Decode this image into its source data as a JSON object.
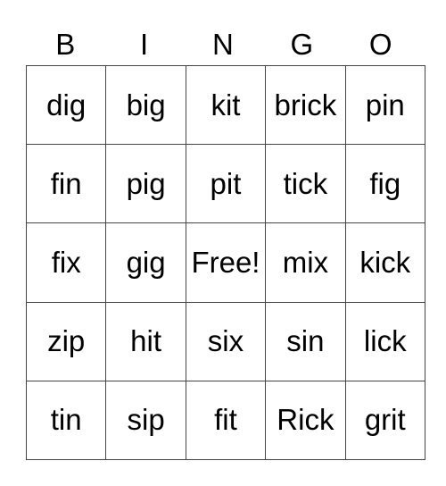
{
  "header": [
    "B",
    "I",
    "N",
    "G",
    "O"
  ],
  "rows": [
    [
      "dig",
      "big",
      "kit",
      "brick",
      "pin"
    ],
    [
      "fin",
      "pig",
      "pit",
      "tick",
      "fig"
    ],
    [
      "fix",
      "gig",
      "Free!",
      "mix",
      "kick"
    ],
    [
      "zip",
      "hit",
      "six",
      "sin",
      "lick"
    ],
    [
      "tin",
      "sip",
      "fit",
      "Rick",
      "grit"
    ]
  ]
}
